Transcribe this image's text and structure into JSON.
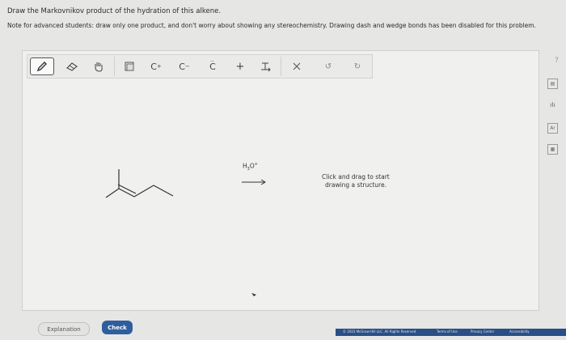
{
  "question": "Draw the Markovnikov product of the hydration of this alkene.",
  "note": "Note for advanced students: draw only one product, and don't worry about showing any stereochemistry. Drawing dash and wedge bonds has been disabled for this problem.",
  "toolbar": {
    "pencil": "pencil-tool",
    "eraser": "eraser-tool",
    "hand": "hand-tool",
    "copy": "copy-tool",
    "cation_label": "C",
    "cation_charge": "+",
    "anion_label": "C",
    "anion_charge": "−",
    "lone_pair_label": "C",
    "plus_label": "+",
    "undo_symbol": "↺",
    "redo_symbol": "↻"
  },
  "reagent": {
    "main": "H",
    "sub": "3",
    "o": "O",
    "charge": "+"
  },
  "hint": {
    "line1": "Click and drag to start",
    "line2": "drawing a structure."
  },
  "buttons": {
    "explanation": "Explanation",
    "check": "Check"
  },
  "help": "?",
  "footer": {
    "copyright": "© 2023 McGraw Hill LLC. All Rights Reserved.",
    "terms": "Terms of Use",
    "privacy": "Privacy Center",
    "accessibility": "Accessibility"
  },
  "colors": {
    "check_button": "#2f5e9e",
    "footer": "#2a4f86",
    "canvas": "#f0f0ee"
  }
}
